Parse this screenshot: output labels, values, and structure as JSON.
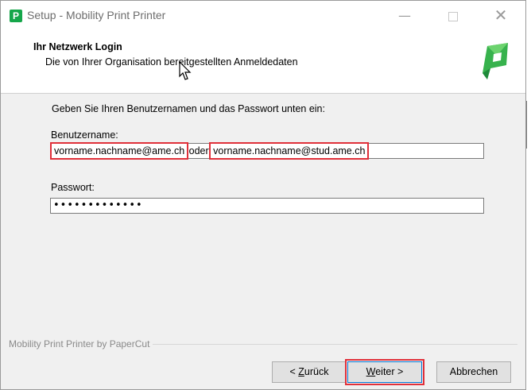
{
  "window": {
    "title": "Setup - Mobility Print Printer",
    "app_icon_letter": "P"
  },
  "header": {
    "title": "Ihr Netzwerk Login",
    "subtitle": "Die von Ihrer Organisation bereitgestellten Anmeldedaten"
  },
  "form": {
    "instruction": "Geben Sie Ihren Benutzernamen und das Passwort unten ein:",
    "username_label": "Benutzername:",
    "username_example_1": "vorname.nachname@ame.ch",
    "username_separator": "oder",
    "username_example_2": "vorname.nachname@stud.ame.ch",
    "password_label": "Passwort:",
    "password_mask": "•••••••••••••"
  },
  "footer": {
    "brand_text": "Mobility Print Printer by PaperCut"
  },
  "buttons": {
    "back_prefix": "< ",
    "back_accel": "Z",
    "back_rest": "urück",
    "next_accel": "W",
    "next_rest": "eiter >",
    "cancel": "Abbrechen"
  },
  "colors": {
    "highlight": "#e0303a",
    "brand_green": "#15a64a"
  }
}
